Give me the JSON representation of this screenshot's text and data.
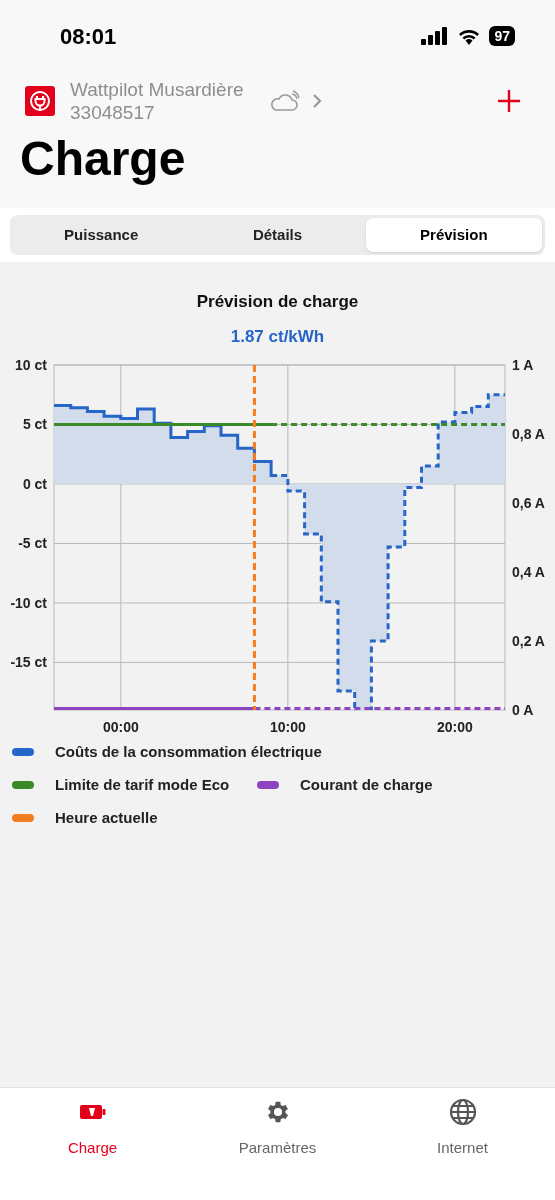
{
  "status_bar": {
    "time": "08:01",
    "battery": "97"
  },
  "device": {
    "name": "Wattpilot Musardière",
    "serial": "33048517"
  },
  "page_title": "Charge",
  "tabs": [
    {
      "label": "Puissance",
      "selected": false
    },
    {
      "label": "Détails",
      "selected": false
    },
    {
      "label": "Prévision",
      "selected": true
    }
  ],
  "forecast": {
    "current_price": "1.87 ct/kWh",
    "chart_data": {
      "type": "line",
      "title": "Prévision de charge",
      "grid": true,
      "x": [
        -4,
        -3,
        -3,
        -2,
        -2,
        -1,
        -1,
        0,
        0,
        1,
        1,
        2,
        2,
        3,
        3,
        4,
        4,
        5,
        5,
        6,
        6,
        7,
        7,
        8,
        8,
        9,
        9,
        10,
        10,
        11,
        11,
        12,
        12,
        13,
        13,
        14,
        14,
        15,
        15,
        16,
        16,
        17,
        17,
        18,
        18,
        19,
        19,
        20,
        20,
        21,
        21,
        22,
        22,
        23
      ],
      "xlim": [
        -4,
        23
      ],
      "ylim": [
        -19,
        10
      ],
      "y2lim": [
        0,
        1
      ],
      "xticks": [
        {
          "value": 0,
          "label": "00:00"
        },
        {
          "value": 10,
          "label": "10:00"
        },
        {
          "value": 20,
          "label": "20:00"
        }
      ],
      "yticks": [
        {
          "value": 10,
          "label": "10 ct"
        },
        {
          "value": 5,
          "label": "5 ct"
        },
        {
          "value": 0,
          "label": "0 ct"
        },
        {
          "value": -5,
          "label": "-5 ct"
        },
        {
          "value": -10,
          "label": "-10 ct"
        },
        {
          "value": -15,
          "label": "-15 ct"
        }
      ],
      "y2ticks": [
        {
          "value": 1,
          "label": "1 A"
        },
        {
          "value": 0.8,
          "label": "0,8 A"
        },
        {
          "value": 0.6,
          "label": "0,6 A"
        },
        {
          "value": 0.4,
          "label": "0,4 A"
        },
        {
          "value": 0.2,
          "label": "0,2 A"
        },
        {
          "value": 0,
          "label": "0 A"
        }
      ],
      "series": [
        {
          "name": "Coûts de la consommation électrique",
          "color": "#2566c8",
          "line_style": "dashed",
          "values": [
            6.6,
            6.6,
            6.4,
            6.4,
            6.1,
            6.1,
            5.7,
            5.7,
            5.5,
            5.5,
            6.3,
            6.3,
            5.1,
            5.1,
            3.9,
            3.9,
            4.4,
            4.4,
            4.9,
            4.9,
            4.1,
            4.1,
            3.0,
            3.0,
            1.9,
            1.9,
            0.7,
            0.7,
            -0.6,
            -0.6,
            -4.2,
            -4.2,
            -9.9,
            -9.9,
            -17.4,
            -17.4,
            null,
            null,
            -13.2,
            -13.2,
            -5.3,
            -5.3,
            -0.3,
            -0.3,
            1.5,
            1.5,
            5.2,
            5.2,
            6.0,
            6.0,
            6.5,
            6.5,
            7.5,
            7.5
          ]
        },
        {
          "name": "Limite de tarif mode Eco",
          "color": "#3a8a2a",
          "line_style": "dashed",
          "values": [
            5,
            5,
            5,
            5,
            5,
            5,
            5,
            5,
            5,
            5,
            5,
            5,
            5,
            5,
            5,
            5,
            5,
            5,
            5,
            5,
            5,
            5,
            5,
            5,
            5,
            5,
            5,
            5,
            5,
            5,
            5,
            5,
            5,
            5,
            5,
            5,
            5,
            5,
            5,
            5,
            5,
            5,
            5,
            5,
            5,
            5,
            5,
            5,
            5,
            5,
            5,
            5,
            5,
            5
          ]
        },
        {
          "name": "Courant de charge",
          "color": "#8e44c0",
          "axis": "y2",
          "line_style": "dashed",
          "values": [
            0,
            0,
            0,
            0,
            0,
            0,
            0,
            0,
            0,
            0,
            0,
            0,
            0,
            0,
            0,
            0,
            0,
            0,
            0,
            0,
            0,
            0,
            0,
            0,
            0,
            0,
            0,
            0,
            0,
            0,
            0,
            0,
            0,
            0,
            0,
            0,
            0,
            0,
            0,
            0,
            0,
            0,
            0,
            0,
            0,
            0,
            0,
            0,
            0,
            0,
            0,
            0,
            0,
            0
          ]
        }
      ],
      "ref_lines": [
        {
          "axis": "x",
          "value": 8,
          "label": "Heure actuelle"
        }
      ]
    }
  },
  "bottom_nav": [
    {
      "kind": "battery",
      "label": "Charge",
      "selected": true
    },
    {
      "kind": "gear",
      "label": "Paramètres",
      "selected": false
    },
    {
      "kind": "globe",
      "label": "Internet",
      "selected": false
    }
  ]
}
